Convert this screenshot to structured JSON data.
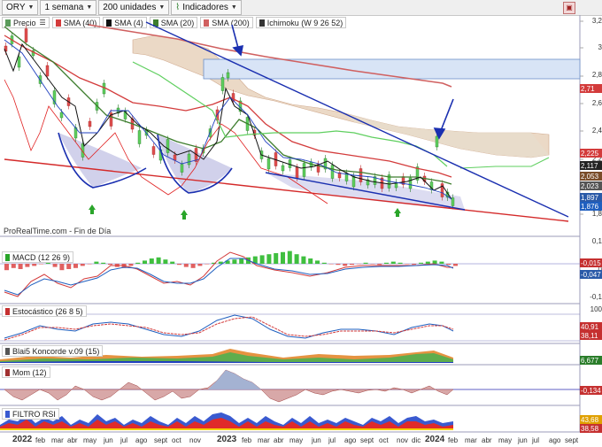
{
  "toolbar": {
    "symbol": "ORY",
    "period": "1 semana",
    "units": "200 unidades",
    "indicators": "Indicadores"
  },
  "legend": [
    {
      "label": "Precio",
      "color": "#5b9b5b"
    },
    {
      "label": "SMA (40)",
      "color": "#d33b3b"
    },
    {
      "label": "SMA (4)",
      "color": "#111111"
    },
    {
      "label": "SMA (20)",
      "color": "#3d7d2d"
    },
    {
      "label": "SMA (200)",
      "color": "#d06060"
    },
    {
      "label": "Ichimoku (W 9 26 52)",
      "color": "#333333"
    }
  ],
  "watermark": "ProRealTime.com - Fin de Día",
  "panels": {
    "macd": {
      "label": "MACD (12 26 9)"
    },
    "stoch": {
      "label": "Estocástico (26 8 5)"
    },
    "blai": {
      "label": "Blai5 Koncorde v.09 (15)"
    },
    "mom": {
      "label": "Mom (12)"
    },
    "rsi": {
      "label": "FILTRO RSI"
    }
  },
  "price_axis": [
    "3,2",
    "3",
    "2,8",
    "2,6",
    "2,4",
    "2,2",
    "2",
    "1,8"
  ],
  "price_tags": [
    {
      "text": "2,71",
      "color": "#d33b3b"
    },
    {
      "text": "2,225",
      "color": "#d33b3b"
    },
    {
      "text": "2,117",
      "color": "#222222"
    },
    {
      "text": "2,053",
      "color": "#7a4d2a"
    },
    {
      "text": "2,023",
      "color": "#555555"
    },
    {
      "text": "1,897",
      "color": "#2a5aa8"
    },
    {
      "text": "1,876",
      "color": "#1f5fbf"
    }
  ],
  "macd_axis": [
    "0,1",
    "0",
    "-0,1"
  ],
  "macd_tags": [
    {
      "text": "-0,015",
      "color": "#c53030"
    },
    {
      "text": "-0,047",
      "color": "#2a5aa8"
    }
  ],
  "stoch_axis": [
    "100"
  ],
  "stoch_tags": [
    {
      "text": "40,91",
      "color": "#c53030"
    },
    {
      "text": "38,11",
      "color": "#c53030"
    }
  ],
  "blai_tags": [
    {
      "text": "6,677",
      "color": "#2a7d2a"
    }
  ],
  "mom_tags": [
    {
      "text": "-0,134",
      "color": "#c53030"
    }
  ],
  "rsi_tags": [
    {
      "text": "43,68",
      "color": "#e0a000"
    },
    {
      "text": "38,58",
      "color": "#c53030"
    }
  ],
  "x_axis": {
    "year_labels": [
      "2022",
      "2023",
      "2024"
    ],
    "month_labels": [
      "feb",
      "mar",
      "abr",
      "may",
      "jun",
      "jul",
      "ago",
      "sept",
      "oct",
      "nov",
      "feb",
      "mar",
      "abr",
      "may",
      "jun",
      "jul",
      "ago",
      "sept",
      "oct",
      "nov",
      "dic",
      "feb",
      "mar",
      "abr",
      "may",
      "jun",
      "jul",
      "ago",
      "sept"
    ]
  }
}
